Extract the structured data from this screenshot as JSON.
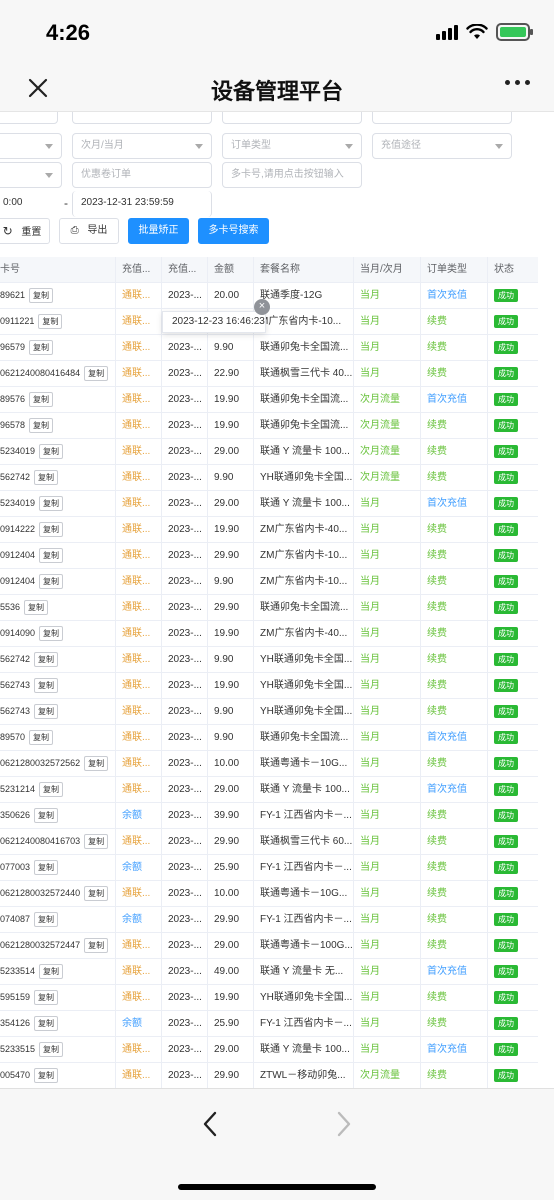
{
  "status_bar": {
    "time": "4:26"
  },
  "nav": {
    "title": "设备管理平台"
  },
  "filters": {
    "row1": [
      "",
      "",
      "",
      ""
    ],
    "month_placeholder": "次月/当月",
    "order_type_placeholder": "订单类型",
    "recharge_channel_placeholder": "充值途径",
    "coupon_order_placeholder": "优惠卷订单",
    "card_search_placeholder": "多卡号,请用点击按钮输入",
    "start_time": "0:00",
    "range_dash": "-",
    "end_time": "2023-12-31 23:59:59"
  },
  "buttons": {
    "reset": "重置",
    "export": "导出",
    "batch_correct": "批量矫正",
    "multi_card_search": "多卡号搜索"
  },
  "table": {
    "headers": [
      "卡号",
      "充值...",
      "充值...",
      "金额",
      "套餐名称",
      "当月/次月",
      "订单类型",
      "状态"
    ],
    "copy_label": "复制",
    "rows": [
      {
        "card": "89621",
        "src": "通联...",
        "time": "2023-...",
        "amount": "20.00",
        "pkg": "联通季度-12G",
        "month": "当月",
        "type": "首次充值",
        "status": "成功"
      },
      {
        "card": "0911221",
        "src": "通联...",
        "time": "",
        "amount": "",
        "pkg": "M广东省内卡-10...",
        "month": "当月",
        "type": "续费",
        "status": "成功"
      },
      {
        "card": "96579",
        "src": "通联...",
        "time": "2023-...",
        "amount": "9.90",
        "pkg": "联通卯兔卡全国流...",
        "month": "当月",
        "type": "续费",
        "status": "成功"
      },
      {
        "card": "0621240080416484",
        "src": "通联...",
        "time": "2023-...",
        "amount": "22.90",
        "pkg": "联通枫雪三代卡 40...",
        "month": "当月",
        "type": "续费",
        "status": "成功"
      },
      {
        "card": "89576",
        "src": "通联...",
        "time": "2023-...",
        "amount": "19.90",
        "pkg": "联通卯兔卡全国流...",
        "month": "次月流量",
        "type": "首次充值",
        "status": "成功"
      },
      {
        "card": "96578",
        "src": "通联...",
        "time": "2023-...",
        "amount": "19.90",
        "pkg": "联通卯兔卡全国流...",
        "month": "次月流量",
        "type": "续费",
        "status": "成功"
      },
      {
        "card": "5234019",
        "src": "通联...",
        "time": "2023-...",
        "amount": "29.00",
        "pkg": "联通 Y 流量卡 100...",
        "month": "次月流量",
        "type": "续费",
        "status": "成功"
      },
      {
        "card": "562742",
        "src": "通联...",
        "time": "2023-...",
        "amount": "9.90",
        "pkg": "YH联通卯兔卡全国...",
        "month": "次月流量",
        "type": "续费",
        "status": "成功"
      },
      {
        "card": "5234019",
        "src": "通联...",
        "time": "2023-...",
        "amount": "29.00",
        "pkg": "联通 Y 流量卡 100...",
        "month": "当月",
        "type": "首次充值",
        "status": "成功"
      },
      {
        "card": "0914222",
        "src": "通联...",
        "time": "2023-...",
        "amount": "19.90",
        "pkg": "ZM广东省内卡-40...",
        "month": "当月",
        "type": "续费",
        "status": "成功"
      },
      {
        "card": "0912404",
        "src": "通联...",
        "time": "2023-...",
        "amount": "29.90",
        "pkg": "ZM广东省内卡-10...",
        "month": "当月",
        "type": "续费",
        "status": "成功"
      },
      {
        "card": "0912404",
        "src": "通联...",
        "time": "2023-...",
        "amount": "9.90",
        "pkg": "ZM广东省内卡-10...",
        "month": "当月",
        "type": "续费",
        "status": "成功"
      },
      {
        "card": "5536",
        "src": "通联...",
        "time": "2023-...",
        "amount": "29.90",
        "pkg": "联通卯兔卡全国流...",
        "month": "当月",
        "type": "续费",
        "status": "成功"
      },
      {
        "card": "0914090",
        "src": "通联...",
        "time": "2023-...",
        "amount": "19.90",
        "pkg": "ZM广东省内卡-40...",
        "month": "当月",
        "type": "续费",
        "status": "成功"
      },
      {
        "card": "562742",
        "src": "通联...",
        "time": "2023-...",
        "amount": "9.90",
        "pkg": "YH联通卯兔卡全国...",
        "month": "当月",
        "type": "续费",
        "status": "成功"
      },
      {
        "card": "562743",
        "src": "通联...",
        "time": "2023-...",
        "amount": "19.90",
        "pkg": "YH联通卯兔卡全国...",
        "month": "当月",
        "type": "续费",
        "status": "成功"
      },
      {
        "card": "562743",
        "src": "通联...",
        "time": "2023-...",
        "amount": "9.90",
        "pkg": "YH联通卯兔卡全国...",
        "month": "当月",
        "type": "续费",
        "status": "成功"
      },
      {
        "card": "89570",
        "src": "通联...",
        "time": "2023-...",
        "amount": "9.90",
        "pkg": "联通卯兔卡全国流...",
        "month": "当月",
        "type": "首次充值",
        "status": "成功"
      },
      {
        "card": "0621280032572562",
        "src": "通联...",
        "time": "2023-...",
        "amount": "10.00",
        "pkg": "联通粤通卡－10G...",
        "month": "当月",
        "type": "续费",
        "status": "成功"
      },
      {
        "card": "5231214",
        "src": "通联...",
        "time": "2023-...",
        "amount": "29.00",
        "pkg": "联通 Y 流量卡 100...",
        "month": "当月",
        "type": "首次充值",
        "status": "成功"
      },
      {
        "card": "350626",
        "src": "余额",
        "time": "2023-...",
        "amount": "39.90",
        "pkg": "FY-1 江西省内卡－...",
        "month": "当月",
        "type": "续费",
        "status": "成功"
      },
      {
        "card": "0621240080416703",
        "src": "通联...",
        "time": "2023-...",
        "amount": "29.90",
        "pkg": "联通枫雪三代卡 60...",
        "month": "当月",
        "type": "续费",
        "status": "成功"
      },
      {
        "card": "077003",
        "src": "余额",
        "time": "2023-...",
        "amount": "25.90",
        "pkg": "FY-1 江西省内卡－...",
        "month": "当月",
        "type": "续费",
        "status": "成功"
      },
      {
        "card": "0621280032572440",
        "src": "通联...",
        "time": "2023-...",
        "amount": "10.00",
        "pkg": "联通粤通卡－10G...",
        "month": "当月",
        "type": "续费",
        "status": "成功"
      },
      {
        "card": "074087",
        "src": "余额",
        "time": "2023-...",
        "amount": "29.90",
        "pkg": "FY-1 江西省内卡－...",
        "month": "当月",
        "type": "续费",
        "status": "成功"
      },
      {
        "card": "0621280032572447",
        "src": "通联...",
        "time": "2023-...",
        "amount": "29.00",
        "pkg": "联通粤通卡－100G...",
        "month": "当月",
        "type": "续费",
        "status": "成功"
      },
      {
        "card": "5233514",
        "src": "通联...",
        "time": "2023-...",
        "amount": "49.00",
        "pkg": "联通 Y 流量卡 无...",
        "month": "当月",
        "type": "首次充值",
        "status": "成功"
      },
      {
        "card": "595159",
        "src": "通联...",
        "time": "2023-...",
        "amount": "19.90",
        "pkg": "YH联通卯兔卡全国...",
        "month": "当月",
        "type": "续费",
        "status": "成功"
      },
      {
        "card": "354126",
        "src": "余额",
        "time": "2023-...",
        "amount": "25.90",
        "pkg": "FY-1 江西省内卡－...",
        "month": "当月",
        "type": "续费",
        "status": "成功"
      },
      {
        "card": "5233515",
        "src": "通联...",
        "time": "2023-...",
        "amount": "29.00",
        "pkg": "联通 Y 流量卡 100...",
        "month": "当月",
        "type": "首次充值",
        "status": "成功"
      },
      {
        "card": "005470",
        "src": "通联...",
        "time": "2023-...",
        "amount": "29.90",
        "pkg": "ZTWL－移动卯兔...",
        "month": "次月流量",
        "type": "续费",
        "status": "成功"
      }
    ]
  },
  "tooltip": {
    "text": "2023-12-23 16:46:23",
    "close_glyph": "×"
  },
  "colors": {
    "primary": "#1e90ff",
    "success": "#2ab934",
    "green_text": "#67c23a",
    "blue_text": "#409eff",
    "orange_text": "#e6a23c"
  }
}
